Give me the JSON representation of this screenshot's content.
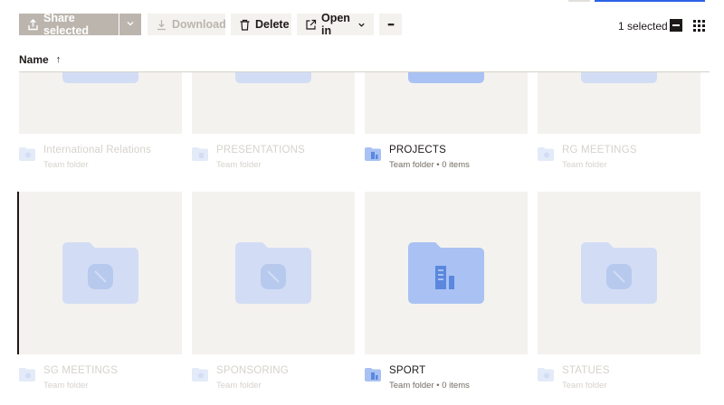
{
  "toolbar": {
    "share_label": "Share selected",
    "download_label": "Download",
    "delete_label": "Delete",
    "open_in_label": "Open in",
    "more_label": "•••"
  },
  "selection": {
    "count_label": "1 selected"
  },
  "sort": {
    "label": "Name",
    "direction_icon": "arrow-up-icon",
    "direction_glyph": "↑"
  },
  "colors": {
    "folder_dim": "#d2ddf5",
    "folder_active": "#a9c2f3",
    "folder_active_icon": "#5b87de",
    "tile_bg": "#f4f2ef",
    "text_dim": "#d6d2cc",
    "accent_blue": "#2c62e6"
  },
  "folders": [
    {
      "name": "International Relations",
      "subtitle": "Team folder",
      "state": "dimmed"
    },
    {
      "name": "PRESENTATIONS",
      "subtitle": "Team folder",
      "state": "dimmed"
    },
    {
      "name": "PROJECTS",
      "subtitle": "Team folder • 0 items",
      "state": "active"
    },
    {
      "name": "RG MEETINGS",
      "subtitle": "Team folder",
      "state": "dimmed"
    },
    {
      "name": "SG MEETINGS",
      "subtitle": "Team folder",
      "state": "dimmed"
    },
    {
      "name": "SPONSORING",
      "subtitle": "Team folder",
      "state": "dimmed"
    },
    {
      "name": "SPORT",
      "subtitle": "Team folder • 0 items",
      "state": "active"
    },
    {
      "name": "STATUES",
      "subtitle": "Team folder",
      "state": "dimmed"
    }
  ]
}
